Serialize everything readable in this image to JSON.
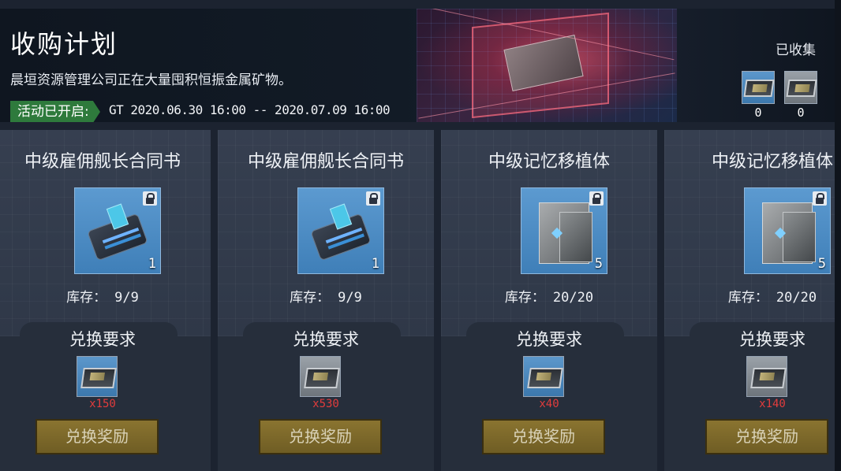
{
  "banner": {
    "title": "收购计划",
    "description": "晨垣资源管理公司正在大量囤积恒振金属矿物。",
    "status_label": "活动已开启:",
    "date_range": "GT 2020.06.30 16:00 -- 2020.07.09 16:00",
    "collected_label": "已收集",
    "collected": [
      {
        "icon": "blue-mineral-icon",
        "count": "0"
      },
      {
        "icon": "grey-mineral-icon",
        "count": "0"
      }
    ]
  },
  "cards": [
    {
      "title": "中级雇佣舰长合同书",
      "item_icon": "captain-contract-icon",
      "item_qty": "1",
      "stock_label": "库存：",
      "stock_value": "9/9",
      "requirement_label": "兑换要求",
      "requirement_icon": "blue-mineral-icon",
      "requirement_count": "x150",
      "button_label": "兑换奖励"
    },
    {
      "title": "中级雇佣舰长合同书",
      "item_icon": "captain-contract-icon",
      "item_qty": "1",
      "stock_label": "库存：",
      "stock_value": "9/9",
      "requirement_label": "兑换要求",
      "requirement_icon": "grey-mineral-icon",
      "requirement_count": "x530",
      "button_label": "兑换奖励"
    },
    {
      "title": "中级记忆移植体",
      "item_icon": "memory-implant-icon",
      "item_qty": "5",
      "stock_label": "库存：",
      "stock_value": "20/20",
      "requirement_label": "兑换要求",
      "requirement_icon": "blue-mineral-icon",
      "requirement_count": "x40",
      "button_label": "兑换奖励"
    },
    {
      "title": "中级记忆移植体",
      "item_icon": "memory-implant-icon",
      "item_qty": "5",
      "stock_label": "库存：",
      "stock_value": "20/20",
      "requirement_label": "兑换要求",
      "requirement_icon": "grey-mineral-icon",
      "requirement_count": "x140",
      "button_label": "兑换奖励"
    }
  ]
}
